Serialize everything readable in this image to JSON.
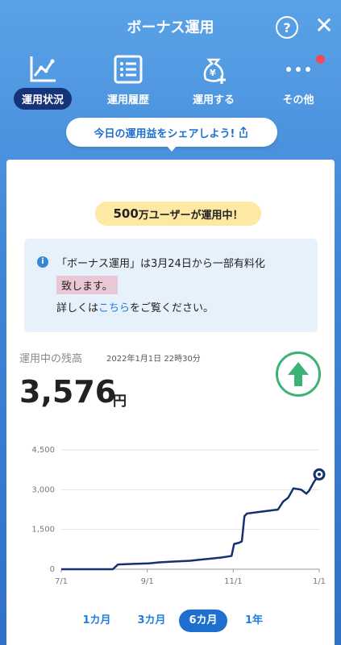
{
  "header": {
    "title": "ボーナス運用",
    "help_label": "?",
    "close_label": "✕"
  },
  "tabs": [
    {
      "label": "運用状況",
      "icon": "line-chart-icon",
      "active": true
    },
    {
      "label": "運用履歴",
      "icon": "list-icon",
      "active": false
    },
    {
      "label": "運用する",
      "icon": "money-bag-plus-icon",
      "active": false
    },
    {
      "label": "その他",
      "icon": "more-dots-icon",
      "active": false
    }
  ],
  "share": {
    "label": "今日の運用益をシェアしよう!"
  },
  "banner": {
    "users_big": "500",
    "users_rest": "万ユーザーが運用中！"
  },
  "notice": {
    "line1": "「ボーナス運用」は3月24日から一部有料化",
    "line2": "致します。",
    "line3_prefix": "詳しくは",
    "line3_link": "こちら",
    "line3_suffix": "をご覧ください。"
  },
  "balance": {
    "label": "運用中の残高",
    "timestamp": "2022年1月1日 22時30分",
    "amount": "3,576",
    "unit": "円"
  },
  "colors": {
    "accent": "#1e6fd0",
    "up_green": "#3ab374",
    "line": "#14306e"
  },
  "chart_data": {
    "type": "line",
    "x_tick_labels": [
      "7/1",
      "9/1",
      "11/1",
      "1/1"
    ],
    "y_tick_labels": [
      "0",
      "1,500",
      "3,000",
      "4,500"
    ],
    "ylim": [
      0,
      4500
    ],
    "grid": true,
    "series": [
      {
        "values": [
          [
            0,
            0
          ],
          [
            0.05,
            0
          ],
          [
            0.1,
            0
          ],
          [
            0.15,
            0
          ],
          [
            0.2,
            0
          ],
          [
            0.22,
            180
          ],
          [
            0.28,
            200
          ],
          [
            0.34,
            220
          ],
          [
            0.38,
            260
          ],
          [
            0.42,
            280
          ],
          [
            0.46,
            300
          ],
          [
            0.5,
            320
          ],
          [
            0.54,
            360
          ],
          [
            0.58,
            400
          ],
          [
            0.62,
            440
          ],
          [
            0.66,
            500
          ],
          [
            0.67,
            950
          ],
          [
            0.69,
            1000
          ],
          [
            0.7,
            1050
          ],
          [
            0.71,
            2000
          ],
          [
            0.72,
            2100
          ],
          [
            0.76,
            2150
          ],
          [
            0.8,
            2200
          ],
          [
            0.84,
            2250
          ],
          [
            0.86,
            2550
          ],
          [
            0.88,
            2700
          ],
          [
            0.9,
            3050
          ],
          [
            0.93,
            3000
          ],
          [
            0.95,
            2850
          ],
          [
            0.96,
            2950
          ],
          [
            0.98,
            3300
          ],
          [
            1.0,
            3576
          ]
        ]
      }
    ]
  },
  "ranges": [
    {
      "label": "1カ月",
      "active": false
    },
    {
      "label": "3カ月",
      "active": false
    },
    {
      "label": "6カ月",
      "active": true
    },
    {
      "label": "1年",
      "active": false
    }
  ]
}
